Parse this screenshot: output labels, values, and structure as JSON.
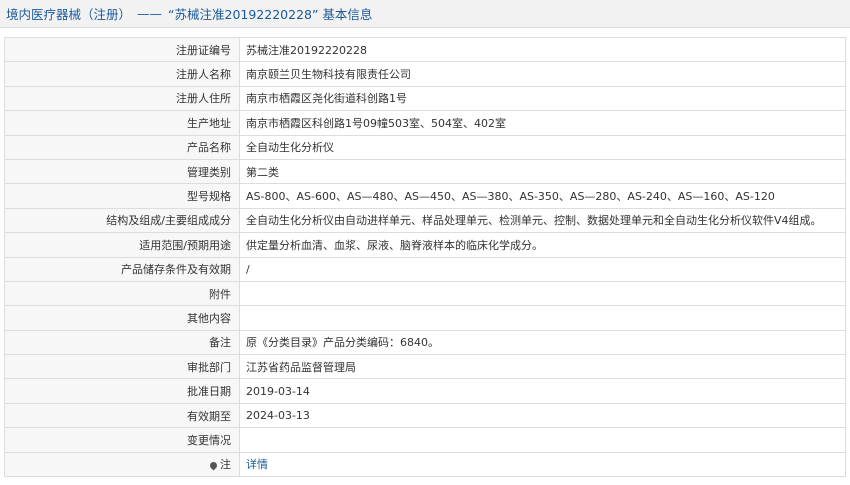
{
  "header": {
    "category": "境内医疗器械（注册）",
    "separator": "——",
    "record_title": "“苏械注准20192220228” 基本信息"
  },
  "rows": [
    {
      "label": "注册证编号",
      "value": "苏械注准20192220228"
    },
    {
      "label": "注册人名称",
      "value": "南京颐兰贝生物科技有限责任公司"
    },
    {
      "label": "注册人住所",
      "value": "南京市栖霞区尧化街道科创路1号"
    },
    {
      "label": "生产地址",
      "value": "南京市栖霞区科创路1号09幢503室、504室、402室"
    },
    {
      "label": "产品名称",
      "value": "全自动生化分析仪"
    },
    {
      "label": "管理类别",
      "value": "第二类"
    },
    {
      "label": "型号规格",
      "value": "AS-800、AS-600、AS—480、AS—450、AS—380、AS-350、AS—280、AS-240、AS—160、AS-120"
    },
    {
      "label": "结构及组成/主要组成成分",
      "value": "全自动生化分析仪由自动进样单元、样品处理单元、检测单元、控制、数据处理单元和全自动生化分析仪软件V4组成。"
    },
    {
      "label": "适用范围/预期用途",
      "value": "供定量分析血清、血浆、尿液、脑脊液样本的临床化学成分。"
    },
    {
      "label": "产品储存条件及有效期",
      "value": "/"
    },
    {
      "label": "附件",
      "value": ""
    },
    {
      "label": "其他内容",
      "value": ""
    },
    {
      "label": "备注",
      "value": "原《分类目录》产品分类编码：6840。"
    },
    {
      "label": "审批部门",
      "value": "江苏省药品监督管理局"
    },
    {
      "label": "批准日期",
      "value": "2019-03-14"
    },
    {
      "label": "有效期至",
      "value": "2024-03-13"
    },
    {
      "label": "变更情况",
      "value": ""
    }
  ],
  "note_row": {
    "icon": "pin-icon",
    "label": "注",
    "link_text": "详情"
  }
}
